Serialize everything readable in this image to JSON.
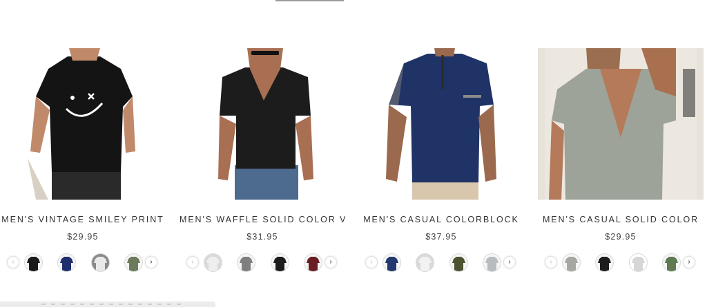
{
  "products": [
    {
      "title": "MEN'S VINTAGE SMILEY PRINT",
      "price": "$29.95",
      "tee_color": "#141414",
      "swatches": [
        {
          "name": "black-print",
          "color": "#1a1a1a"
        },
        {
          "name": "navy-print",
          "color": "#1f2f6e"
        },
        {
          "name": "white-print",
          "color": "#e9e9e9"
        },
        {
          "name": "olive-print",
          "color": "#6d7a5c"
        }
      ]
    },
    {
      "title": "MEN'S WAFFLE SOLID COLOR V",
      "price": "$31.95",
      "tee_color": "#1c1c1c",
      "swatches": [
        {
          "name": "white",
          "color": "#eeeeee"
        },
        {
          "name": "gray",
          "color": "#7f7f7f"
        },
        {
          "name": "black",
          "color": "#1b1b1b"
        },
        {
          "name": "burgundy",
          "color": "#6a1d24"
        }
      ]
    },
    {
      "title": "MEN'S CASUAL COLORBLOCK",
      "price": "$37.95",
      "tee_color": "#1f3366",
      "swatches": [
        {
          "name": "navy",
          "color": "#22386e"
        },
        {
          "name": "white",
          "color": "#f2f2f2"
        },
        {
          "name": "army-green",
          "color": "#4d5230"
        },
        {
          "name": "light-gray",
          "color": "#b8bcc0"
        }
      ]
    },
    {
      "title": "MEN'S CASUAL SOLID COLOR",
      "price": "$29.95",
      "tee_color": "#9ea39a",
      "swatches": [
        {
          "name": "gray",
          "color": "#a5a8a2"
        },
        {
          "name": "black",
          "color": "#1d1d1d"
        },
        {
          "name": "light-gray",
          "color": "#d6d6d6"
        },
        {
          "name": "green",
          "color": "#5f7a52"
        }
      ]
    }
  ],
  "icons": {
    "prev": "chevron-left-icon",
    "next": "chevron-right-icon"
  },
  "glyphs": {
    "prev": "‹",
    "next": "›"
  }
}
